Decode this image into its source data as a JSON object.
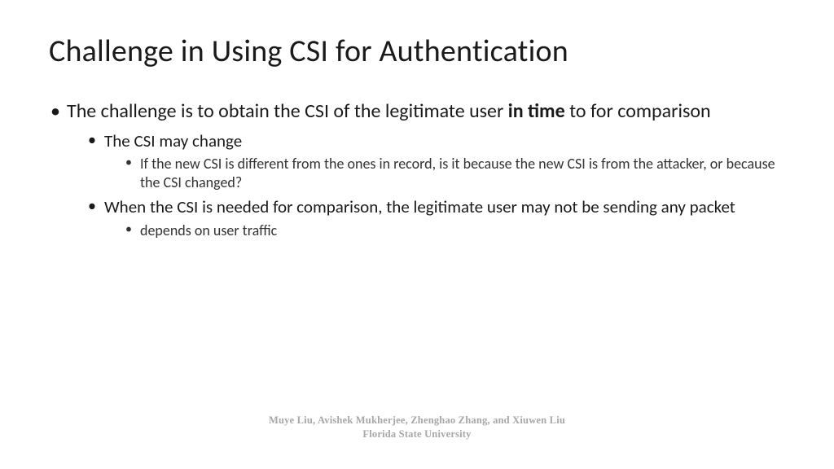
{
  "title": "Challenge in Using CSI for Authentication",
  "bullets": {
    "l1a_pre": "The challenge is to obtain the CSI of the legitimate user ",
    "l1a_bold": "in time",
    "l1a_post": " to for comparison",
    "l2a": "The CSI may change",
    "l3a": "If the new CSI is different from the ones in record, is it because the new CSI is from the attacker, or because the CSI changed?",
    "l2b": "When the CSI is needed for comparison, the legitimate user may not be sending any packet",
    "l3b": "depends on user traffic"
  },
  "footer": {
    "authors": "Muye Liu, Avishek Mukherjee, Zhenghao Zhang, and Xiuwen Liu",
    "affiliation": "Florida State University"
  }
}
